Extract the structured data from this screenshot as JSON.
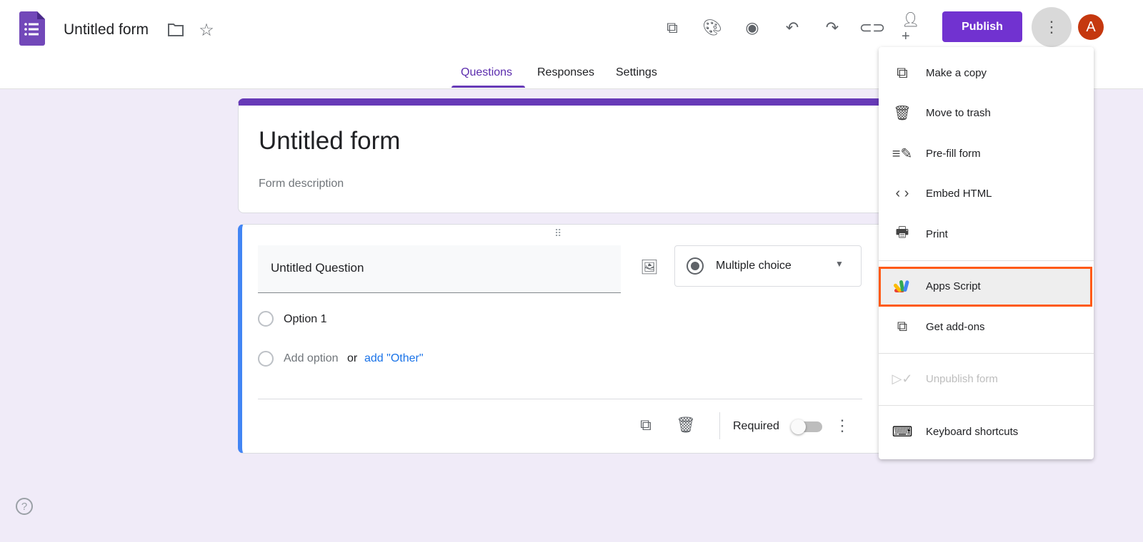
{
  "header": {
    "title": "Untitled form",
    "publish_label": "Publish",
    "avatar_letter": "A"
  },
  "tabs": [
    {
      "label": "Questions",
      "active": true
    },
    {
      "label": "Responses"
    },
    {
      "label": "Settings"
    }
  ],
  "form": {
    "title": "Untitled form",
    "description_placeholder": "Form description"
  },
  "question": {
    "title": "Untitled Question",
    "type": "Multiple choice",
    "options": [
      "Option 1"
    ],
    "add_option": "Add option",
    "or": "or",
    "add_other": "add \"Other\"",
    "required_label": "Required",
    "required": false
  },
  "menu": {
    "items": [
      {
        "label": "Make a copy",
        "icon": "copy-icon"
      },
      {
        "label": "Move to trash",
        "icon": "trash-icon"
      },
      {
        "label": "Pre-fill form",
        "icon": "prefill-icon"
      },
      {
        "label": "Embed HTML",
        "icon": "code-icon"
      },
      {
        "label": "Print",
        "icon": "print-icon"
      },
      {
        "label": "Apps Script",
        "icon": "apps-script-icon",
        "highlighted": true
      },
      {
        "label": "Get add-ons",
        "icon": "addon-icon"
      },
      {
        "label": "Unpublish form",
        "icon": "unpublish-icon",
        "disabled": true
      },
      {
        "label": "Keyboard shortcuts",
        "icon": "keyboard-icon"
      }
    ]
  },
  "colors": {
    "accent": "#673ab7",
    "publish": "#7132d0",
    "avatar": "#c5380f",
    "highlight": "#ff5a14",
    "question_border": "#4285f4",
    "link": "#1a73e8"
  }
}
